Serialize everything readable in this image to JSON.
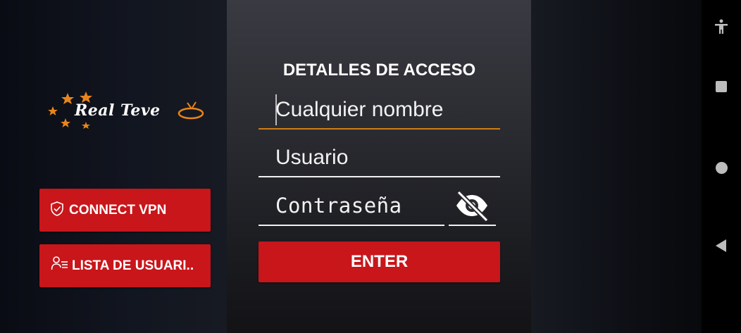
{
  "brand": {
    "name": "Real Teve"
  },
  "sidebar": {
    "vpn_button": {
      "label": "CONNECT VPN",
      "icon": "shield-check-icon"
    },
    "users_button": {
      "label": "LISTA DE USUARI..",
      "icon": "user-list-icon"
    }
  },
  "form": {
    "title": "DETALLES DE ACCESO",
    "name_field": {
      "placeholder": "Cualquier nombre"
    },
    "user_field": {
      "placeholder": "Usuario"
    },
    "password_field": {
      "placeholder": "Contraseña",
      "toggle_icon": "eye-off-icon"
    },
    "enter_button": {
      "label": "ENTER"
    }
  },
  "system_nav": {
    "icons": [
      "accessibility-icon",
      "recents-square-icon",
      "home-circle-icon",
      "back-triangle-icon"
    ]
  },
  "colors": {
    "accent_red": "#c8161b",
    "focus_underline": "#d07d12",
    "logo_orange": "#e8841a"
  }
}
